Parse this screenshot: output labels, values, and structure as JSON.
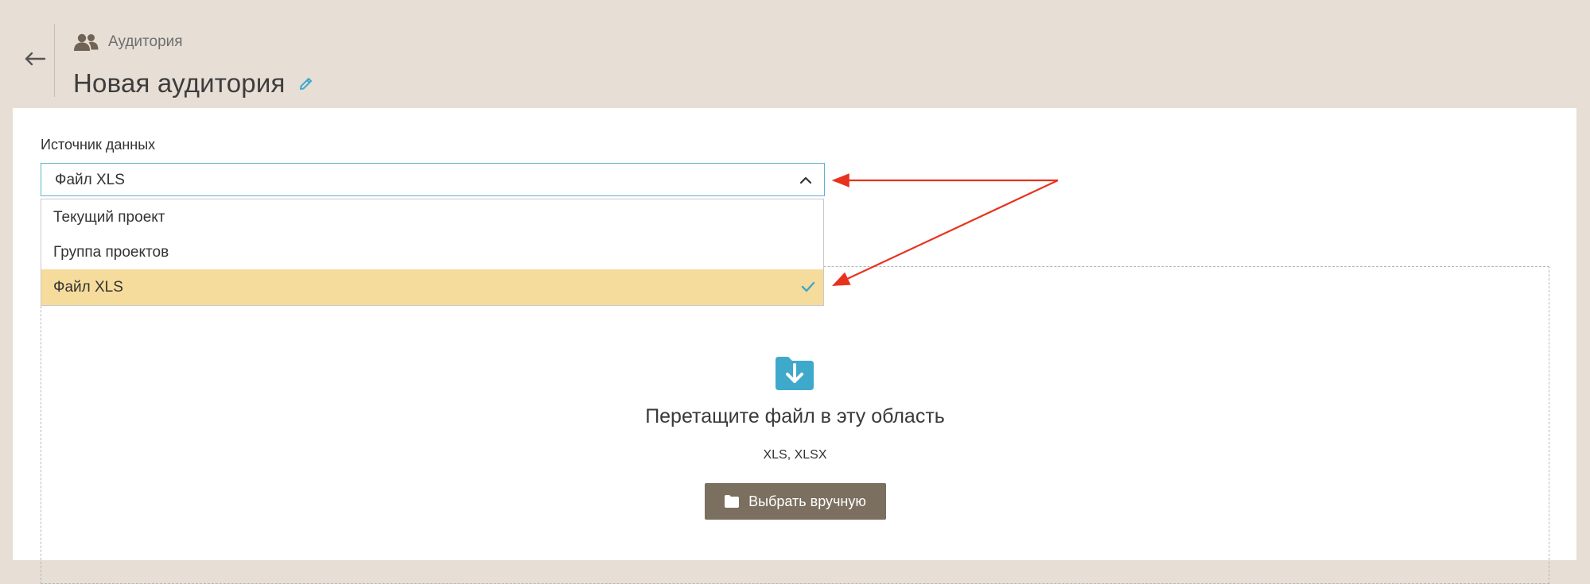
{
  "header": {
    "breadcrumb_label": "Аудитория",
    "title": "Новая аудитория",
    "icons": {
      "back": "arrow-left-icon",
      "breadcrumb": "users-icon",
      "edit": "pencil-icon"
    }
  },
  "form": {
    "field_label": "Источник данных",
    "selected_value": "Файл XLS",
    "options": [
      {
        "label": "Текущий проект",
        "selected": false
      },
      {
        "label": "Группа проектов",
        "selected": false
      },
      {
        "label": "Файл XLS",
        "selected": true
      }
    ]
  },
  "dropzone": {
    "title": "Перетащите файл в эту область",
    "formats": "XLS, XLSX",
    "button_label": "Выбрать вручную",
    "icons": {
      "upload": "folder-download-icon",
      "button": "folder-icon"
    }
  },
  "colors": {
    "header_bg": "#e7ded5",
    "accent_blue": "#3fa9cc",
    "selected_option_bg": "#f6dc9c",
    "button_bg": "#7b6f60",
    "annotation_red": "#e8321e"
  }
}
